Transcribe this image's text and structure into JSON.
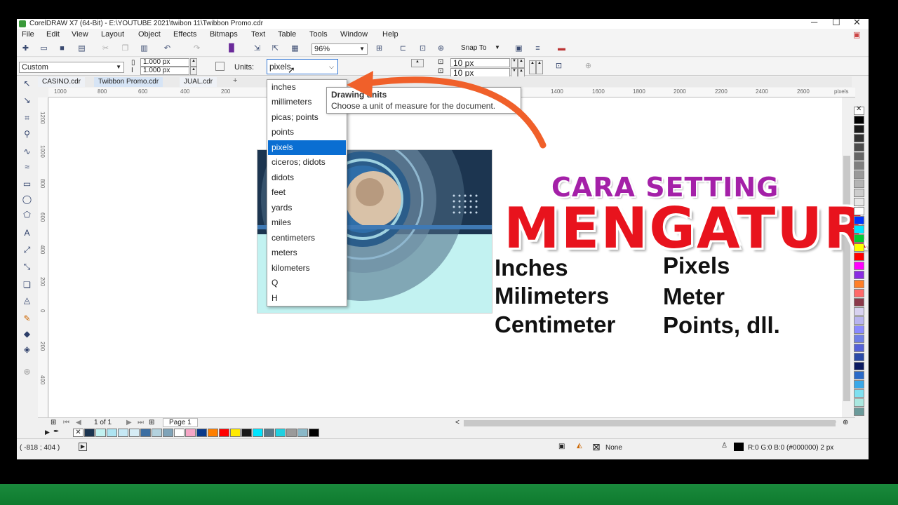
{
  "window": {
    "title": "CorelDRAW X7 (64-Bit) - E:\\YOUTUBE 2021\\twibon 11\\Twibbon Promo.cdr"
  },
  "menu": [
    "File",
    "Edit",
    "View",
    "Layout",
    "Object",
    "Effects",
    "Bitmaps",
    "Text",
    "Table",
    "Tools",
    "Window",
    "Help"
  ],
  "toolbar": {
    "zoom": "96%",
    "snap_to": "Snap To"
  },
  "property_bar": {
    "page_preset": "Custom",
    "width": "1.000 px",
    "height": "1.000 px",
    "units_label": "Units:",
    "units_value": "pixels",
    "nudge_x": "10 px",
    "nudge_y": "10 px"
  },
  "tabs": [
    "CASINO.cdr",
    "Twibbon Promo.cdr",
    "JUAL.cdr"
  ],
  "ruler_top": [
    "1000",
    "800",
    "600",
    "400",
    "200",
    "1400",
    "1600",
    "1800",
    "2000",
    "2200",
    "2400",
    "2600",
    "pixels"
  ],
  "ruler_left": [
    "1200",
    "1000",
    "800",
    "600",
    "400",
    "200",
    "0",
    "200",
    "400"
  ],
  "units_options": [
    "inches",
    "millimeters",
    "picas; points",
    "points",
    "pixels",
    "ciceros; didots",
    "didots",
    "feet",
    "yards",
    "miles",
    "centimeters",
    "meters",
    "kilometers",
    "Q",
    "H"
  ],
  "units_selected": "pixels",
  "tooltip": {
    "title": "Drawing units",
    "description": "Choose a unit of measure for the document."
  },
  "overlay": {
    "headline_small": "CARA SETTING",
    "headline_big": "MENGATUR",
    "col1": [
      "Inches",
      "Milimeters",
      "Centimeter"
    ],
    "col2": [
      "Pixels",
      "Meter",
      "Points, dll."
    ]
  },
  "page_nav": {
    "count": "1 of 1",
    "page_tab": "Page 1"
  },
  "status": {
    "coords": "( -818 ; 404   )",
    "fill": "None",
    "outline": "R:0 G:0 B:0 (#000000)  2 px"
  },
  "colors": {
    "accent_arrow": "#f0602a",
    "headline_purple": "#a420a8",
    "headline_red": "#e8131d",
    "selection": "#0a6ed2"
  }
}
